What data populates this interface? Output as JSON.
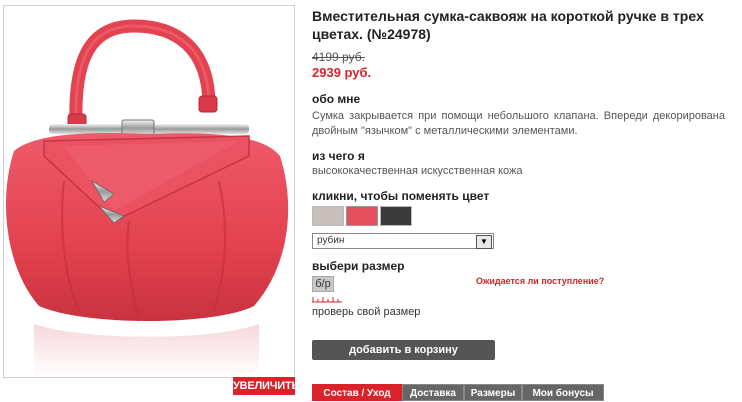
{
  "product": {
    "title": "Вместительная сумка-саквояж на короткой ручке в трех цветах. (№24978)",
    "old_price": "4199 руб.",
    "new_price": "2939 руб.",
    "zoom_label": "УВЕЛИЧИТЬ"
  },
  "about": {
    "heading": "обо мне",
    "text": "Сумка закрывается при помощи небольшого клапана. Впереди декорирована двойным \"язычком\" с металлическими элементами."
  },
  "material": {
    "heading": "из чего я",
    "text": "высококачественная искусственная кожа"
  },
  "color": {
    "heading": "кликни, чтобы поменять цвет",
    "swatches": [
      {
        "name": "beige",
        "color": "#c8bebc"
      },
      {
        "name": "ruby",
        "color": "#e5505e"
      },
      {
        "name": "black",
        "color": "#3a3a3a"
      }
    ],
    "selected": "рубин"
  },
  "size": {
    "heading": "выбери размер",
    "option": "б/р",
    "notify_label": "Ожидается ли поступление?",
    "check_label": "проверь свой размер"
  },
  "cart": {
    "button_label": "добавить в корзину"
  },
  "tabs": [
    {
      "label": "Состав / Уход",
      "active": true
    },
    {
      "label": "Доставка",
      "active": false
    },
    {
      "label": "Размеры",
      "active": false
    },
    {
      "label": "Мои бонусы",
      "active": false
    }
  ],
  "colors": {
    "accent": "#d9232a",
    "bag": "#e8485a",
    "button_dark": "#555555"
  }
}
